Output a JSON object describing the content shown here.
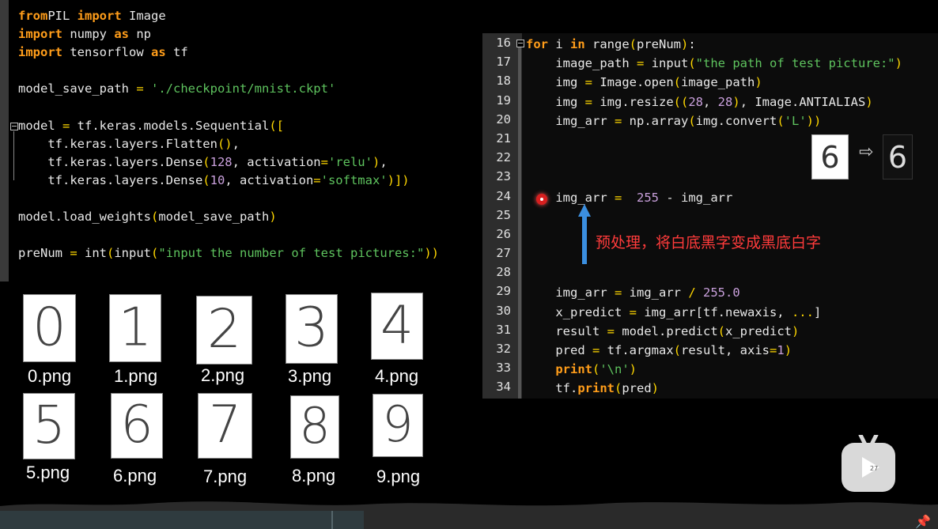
{
  "left_code": {
    "lines": [
      {
        "segs": [
          [
            "kw",
            "from"
          ],
          [
            "",
            "PIL "
          ],
          [
            "kw",
            "import"
          ],
          [
            "",
            " Image"
          ]
        ]
      },
      {
        "segs": [
          [
            "kw",
            "import"
          ],
          [
            "",
            " numpy "
          ],
          [
            "kw",
            "as"
          ],
          [
            "",
            " np"
          ]
        ]
      },
      {
        "segs": [
          [
            "kw",
            "import"
          ],
          [
            "",
            " tensorflow "
          ],
          [
            "kw",
            "as"
          ],
          [
            "",
            " tf"
          ]
        ]
      },
      {
        "segs": []
      },
      {
        "segs": [
          [
            "",
            "model_save_path "
          ],
          [
            "op",
            "="
          ],
          [
            " str",
            "'./checkpoint/mnist.ckpt'"
          ]
        ]
      },
      {
        "segs": []
      },
      {
        "segs": [
          [
            "",
            "model "
          ],
          [
            "op",
            "="
          ],
          [
            "",
            " tf.keras.models.Sequential"
          ],
          [
            "op",
            "(["
          ]
        ]
      },
      {
        "segs": [
          [
            "",
            "    tf.keras.layers.Flatten"
          ],
          [
            "op",
            "()"
          ],
          [
            "",
            ","
          ]
        ]
      },
      {
        "segs": [
          [
            "",
            "    tf.keras.layers.Dense"
          ],
          [
            "op",
            "("
          ],
          [
            "num",
            "128"
          ],
          [
            "",
            ", activation"
          ],
          [
            "op",
            "="
          ],
          [
            "str",
            "'relu'"
          ],
          [
            "op",
            ")"
          ],
          [
            "",
            ","
          ]
        ]
      },
      {
        "segs": [
          [
            "",
            "    tf.keras.layers.Dense"
          ],
          [
            "op",
            "("
          ],
          [
            "num",
            "10"
          ],
          [
            "",
            ", activation"
          ],
          [
            "op",
            "="
          ],
          [
            "str",
            "'softmax'"
          ],
          [
            "op",
            ")])"
          ]
        ]
      },
      {
        "segs": []
      },
      {
        "segs": [
          [
            "",
            "model.load_weights"
          ],
          [
            "op",
            "("
          ],
          [
            "",
            "model_save_path"
          ],
          [
            "op",
            ")"
          ]
        ]
      },
      {
        "segs": []
      },
      {
        "segs": [
          [
            "",
            "preNum "
          ],
          [
            "op",
            "="
          ],
          [
            "",
            " int"
          ],
          [
            "op",
            "("
          ],
          [
            "",
            "input"
          ],
          [
            "op",
            "("
          ],
          [
            "str",
            "\"input the number of test pictures:\""
          ],
          [
            "op",
            "))"
          ]
        ]
      }
    ]
  },
  "right_code": {
    "line_numbers": [
      "16",
      "17",
      "18",
      "19",
      "20",
      "21",
      "22",
      "23",
      "24",
      "25",
      "26",
      "27",
      "28",
      "29",
      "30",
      "31",
      "32",
      "33",
      "34"
    ],
    "lines": [
      {
        "segs": [
          [
            "kw",
            "for"
          ],
          [
            "",
            " i "
          ],
          [
            "kw",
            "in"
          ],
          [
            "",
            " range"
          ],
          [
            "op",
            "("
          ],
          [
            "",
            "preNum"
          ],
          [
            "op",
            ")"
          ],
          [
            "",
            ":"
          ]
        ]
      },
      {
        "segs": [
          [
            "",
            "    image_path "
          ],
          [
            "op",
            "="
          ],
          [
            "",
            " input"
          ],
          [
            "op",
            "("
          ],
          [
            "str",
            "\"the path of test picture:\""
          ],
          [
            "op",
            ")"
          ]
        ]
      },
      {
        "segs": [
          [
            "",
            "    img "
          ],
          [
            "op",
            "="
          ],
          [
            "",
            " Image.open"
          ],
          [
            "op",
            "("
          ],
          [
            "",
            "image_path"
          ],
          [
            "op",
            ")"
          ]
        ]
      },
      {
        "segs": [
          [
            "",
            "    img "
          ],
          [
            "op",
            "="
          ],
          [
            "",
            " img.resize"
          ],
          [
            "op",
            "(("
          ],
          [
            "num",
            "28"
          ],
          [
            "",
            ", "
          ],
          [
            "num",
            "28"
          ],
          [
            "op",
            ")"
          ],
          [
            "",
            ", Image.ANTIALIAS"
          ],
          [
            "op",
            ")"
          ]
        ]
      },
      {
        "segs": [
          [
            "",
            "    img_arr "
          ],
          [
            "op",
            "="
          ],
          [
            "",
            " np.array"
          ],
          [
            "op",
            "("
          ],
          [
            "",
            "img.convert"
          ],
          [
            "op",
            "("
          ],
          [
            "str",
            "'L'"
          ],
          [
            "op",
            "))"
          ]
        ]
      },
      {
        "segs": []
      },
      {
        "segs": []
      },
      {
        "segs": []
      },
      {
        "segs": [
          [
            "",
            "    img_arr "
          ],
          [
            "op",
            "="
          ],
          [
            " num",
            " 255"
          ],
          [
            "",
            " - img_arr"
          ]
        ]
      },
      {
        "segs": []
      },
      {
        "segs": []
      },
      {
        "segs": []
      },
      {
        "segs": []
      },
      {
        "segs": [
          [
            "",
            "    img_arr "
          ],
          [
            "op",
            "="
          ],
          [
            "",
            " img_arr "
          ],
          [
            "op",
            "/"
          ],
          [
            "num",
            " 255.0"
          ]
        ]
      },
      {
        "segs": [
          [
            "",
            "    x_predict "
          ],
          [
            "op",
            "="
          ],
          [
            "",
            " img_arr[tf.newaxis, "
          ],
          [
            "op",
            "..."
          ],
          [
            "",
            "]"
          ]
        ]
      },
      {
        "segs": [
          [
            "",
            "    result "
          ],
          [
            "op",
            "="
          ],
          [
            "",
            " model.predict"
          ],
          [
            "op",
            "("
          ],
          [
            "",
            "x_predict"
          ],
          [
            "op",
            ")"
          ]
        ]
      },
      {
        "segs": [
          [
            "",
            "    pred "
          ],
          [
            "op",
            "="
          ],
          [
            "",
            " tf.argmax"
          ],
          [
            "op",
            "("
          ],
          [
            "",
            "result, axis"
          ],
          [
            "op",
            "="
          ],
          [
            "num",
            "1"
          ],
          [
            "op",
            ")"
          ]
        ]
      },
      {
        "segs": [
          [
            "",
            "    "
          ],
          [
            "kw",
            "print"
          ],
          [
            "op",
            "("
          ],
          [
            "str",
            "'\\n'"
          ],
          [
            "op",
            ")"
          ]
        ]
      },
      {
        "segs": [
          [
            "",
            "    tf."
          ],
          [
            "kw",
            "print"
          ],
          [
            "op",
            "("
          ],
          [
            "",
            "pred"
          ],
          [
            "op",
            ")"
          ]
        ]
      }
    ]
  },
  "digits": [
    {
      "glyph": "0",
      "label": "0.png"
    },
    {
      "glyph": "1",
      "label": "1.png"
    },
    {
      "glyph": "2",
      "label": "2.png"
    },
    {
      "glyph": "3",
      "label": "3.png"
    },
    {
      "glyph": "4",
      "label": "4.png"
    },
    {
      "glyph": "5",
      "label": "5.png"
    },
    {
      "glyph": "6",
      "label": "6.png"
    },
    {
      "glyph": "7",
      "label": "7.png"
    },
    {
      "glyph": "8",
      "label": "8.png"
    },
    {
      "glyph": "9",
      "label": "9.png"
    }
  ],
  "preview": {
    "before": "6",
    "after": "6",
    "arrow": "⇨"
  },
  "annotation": "预处理，将白底黑字变成黑底白字",
  "badge_count": "27",
  "icons": {
    "play": "play-icon",
    "pin": "pin-icon",
    "breakpoint": "breakpoint-icon",
    "arrow": "up-arrow-icon"
  }
}
